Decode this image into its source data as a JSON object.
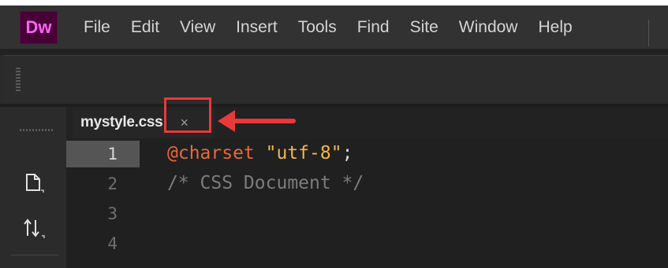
{
  "app": {
    "logo": "Dw"
  },
  "menu": {
    "items": [
      "File",
      "Edit",
      "View",
      "Insert",
      "Tools",
      "Find",
      "Site",
      "Window",
      "Help"
    ]
  },
  "tab": {
    "filename": "mystyle.css",
    "close_glyph": "×"
  },
  "editor": {
    "line_numbers": [
      "1",
      "2",
      "3",
      "4"
    ],
    "lines": [
      {
        "at_rule": "@charset",
        "string": "\"utf-8\"",
        "punct": ";"
      },
      {
        "comment": "/* CSS Document */"
      }
    ]
  },
  "left_panel": {
    "icons": [
      "new-file-icon",
      "sort-icon"
    ]
  },
  "colors": {
    "highlight": "#e9393a",
    "logo_bg": "#470137",
    "logo_fg": "#ff61f6"
  }
}
